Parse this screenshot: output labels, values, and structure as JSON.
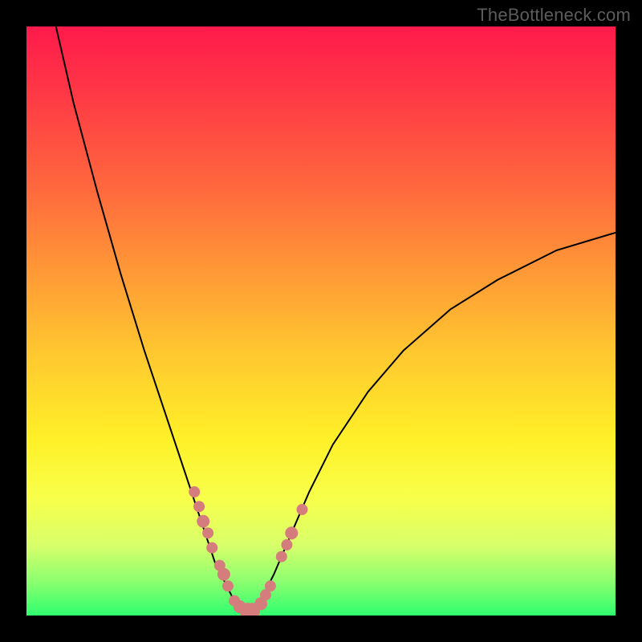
{
  "watermark": "TheBottleneck.com",
  "colors": {
    "background": "#000000",
    "watermark_text": "#5c5c5c",
    "curve_stroke": "#000000",
    "dot_fill": "#d57d7d",
    "gradient_stops": [
      [
        "0%",
        "#ff1a4b"
      ],
      [
        "12%",
        "#ff3a45"
      ],
      [
        "28%",
        "#ff6a3d"
      ],
      [
        "42%",
        "#ff9a36"
      ],
      [
        "56%",
        "#ffc92f"
      ],
      [
        "70%",
        "#fff028"
      ],
      [
        "80%",
        "#f8ff4a"
      ],
      [
        "88%",
        "#d8ff6a"
      ],
      [
        "94%",
        "#8fff6f"
      ],
      [
        "100%",
        "#2fff6f"
      ]
    ]
  },
  "chart_data": {
    "type": "line",
    "title": "",
    "xlabel": "",
    "ylabel": "",
    "xlim": [
      0,
      100
    ],
    "ylim": [
      0,
      100
    ],
    "series": [
      {
        "name": "curve",
        "x": [
          5,
          8,
          12,
          16,
          20,
          24,
          27,
          30,
          32,
          34,
          35.5,
          37,
          38,
          39,
          40,
          42,
          45,
          48,
          52,
          58,
          64,
          72,
          80,
          90,
          100
        ],
        "y": [
          100,
          87,
          72,
          58,
          45,
          33,
          24,
          15,
          9,
          5,
          2,
          0.5,
          0.5,
          1.5,
          3,
          7,
          14,
          21,
          29,
          38,
          45,
          52,
          57,
          62,
          65
        ]
      }
    ],
    "scatter": {
      "name": "dots",
      "x": [
        28.5,
        29.3,
        30.0,
        30.8,
        31.5,
        32.8,
        33.5,
        34.2,
        35.3,
        36.2,
        37.5,
        38.3,
        39.8,
        40.6,
        41.4,
        43.3,
        44.2,
        45.0,
        46.8
      ],
      "y": [
        21.0,
        18.5,
        16.0,
        14.0,
        11.5,
        8.5,
        7.0,
        5.0,
        2.5,
        1.5,
        0.8,
        0.8,
        2.0,
        3.5,
        5.0,
        10.0,
        12.0,
        14.0,
        18.0
      ],
      "r": [
        7,
        7,
        8,
        7,
        7,
        7,
        8,
        7,
        7,
        8,
        10,
        10,
        8,
        7,
        7,
        7,
        7,
        8,
        7
      ]
    }
  }
}
